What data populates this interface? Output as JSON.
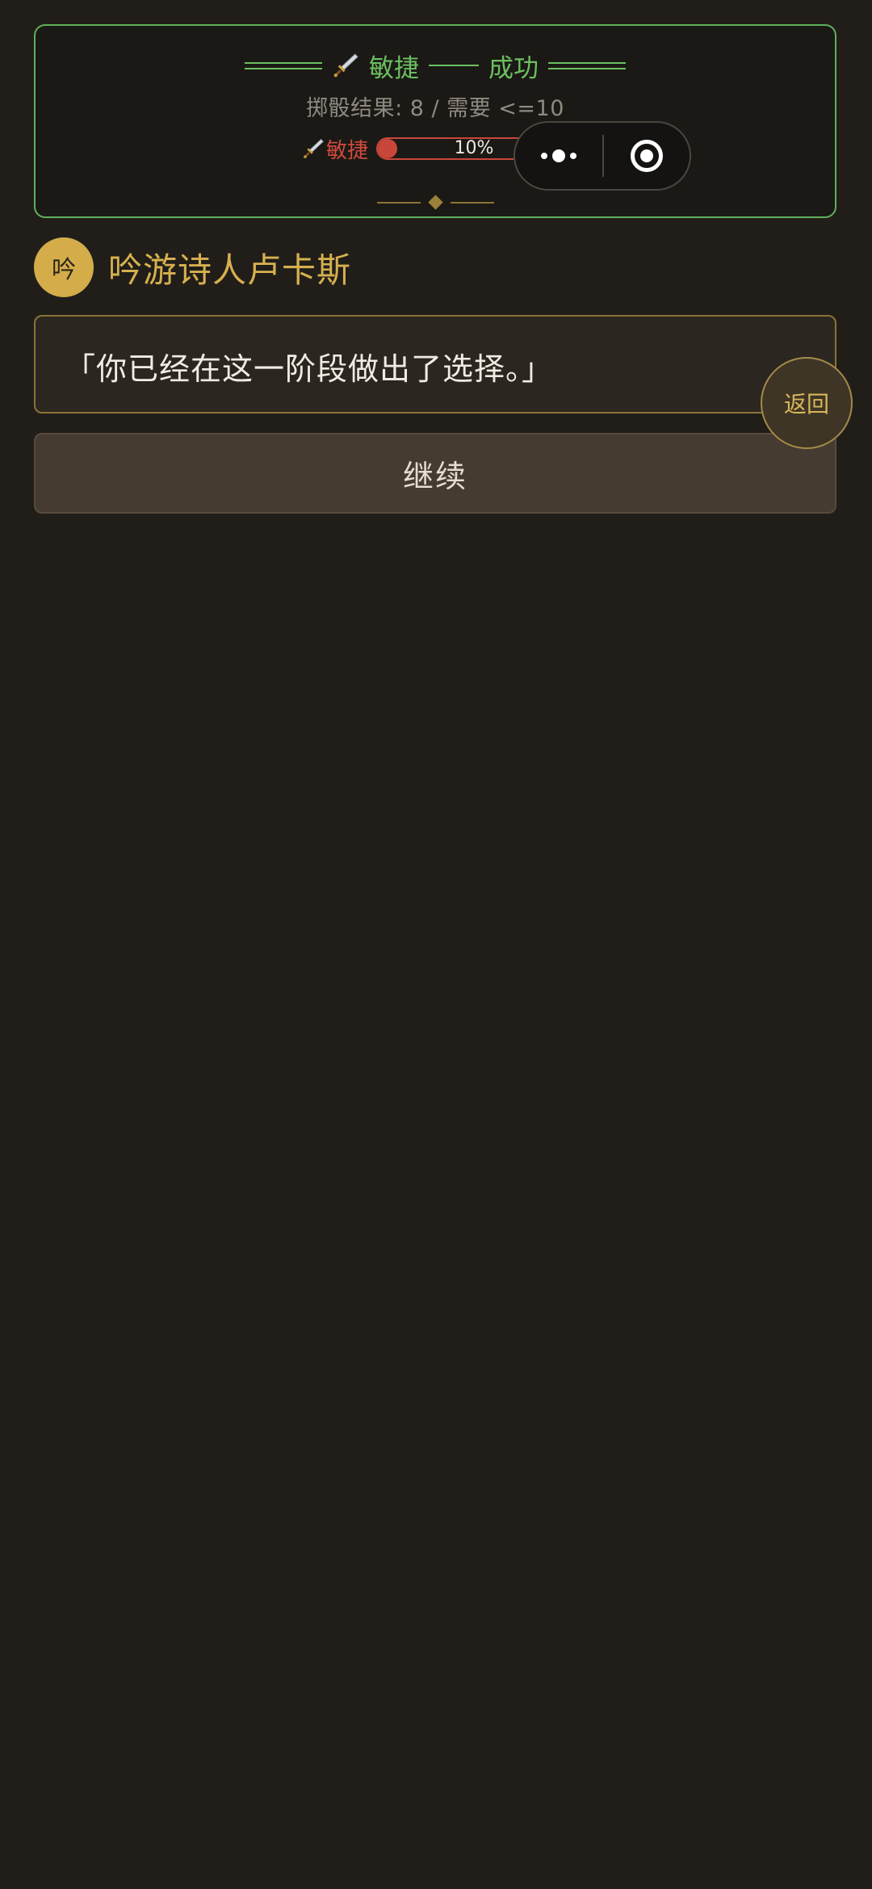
{
  "roll": {
    "stat_name": "敏捷",
    "outcome": "成功",
    "result_text": "掷骰结果: 8 / 需要 <=10",
    "stat_bar": {
      "label": "敏捷",
      "percent": 10,
      "percent_text": "10%"
    },
    "icon": "dagger-icon",
    "colors": {
      "success": "#6cc05f",
      "stat": "#cf4a3c",
      "ornament": "#9b8039"
    }
  },
  "capsule": {
    "more_icon": "more-dots-icon",
    "close_icon": "target-close-icon"
  },
  "speaker": {
    "avatar_char": "吟",
    "name": "吟游诗人卢卡斯"
  },
  "dialogue": {
    "text": "「你已经在这一阶段做出了选择。」"
  },
  "buttons": {
    "back_label": "返回",
    "continue_label": "继续"
  },
  "colors": {
    "background": "#211e1a",
    "accent_gold": "#d7b04e",
    "continue_bg": "#463b30"
  }
}
